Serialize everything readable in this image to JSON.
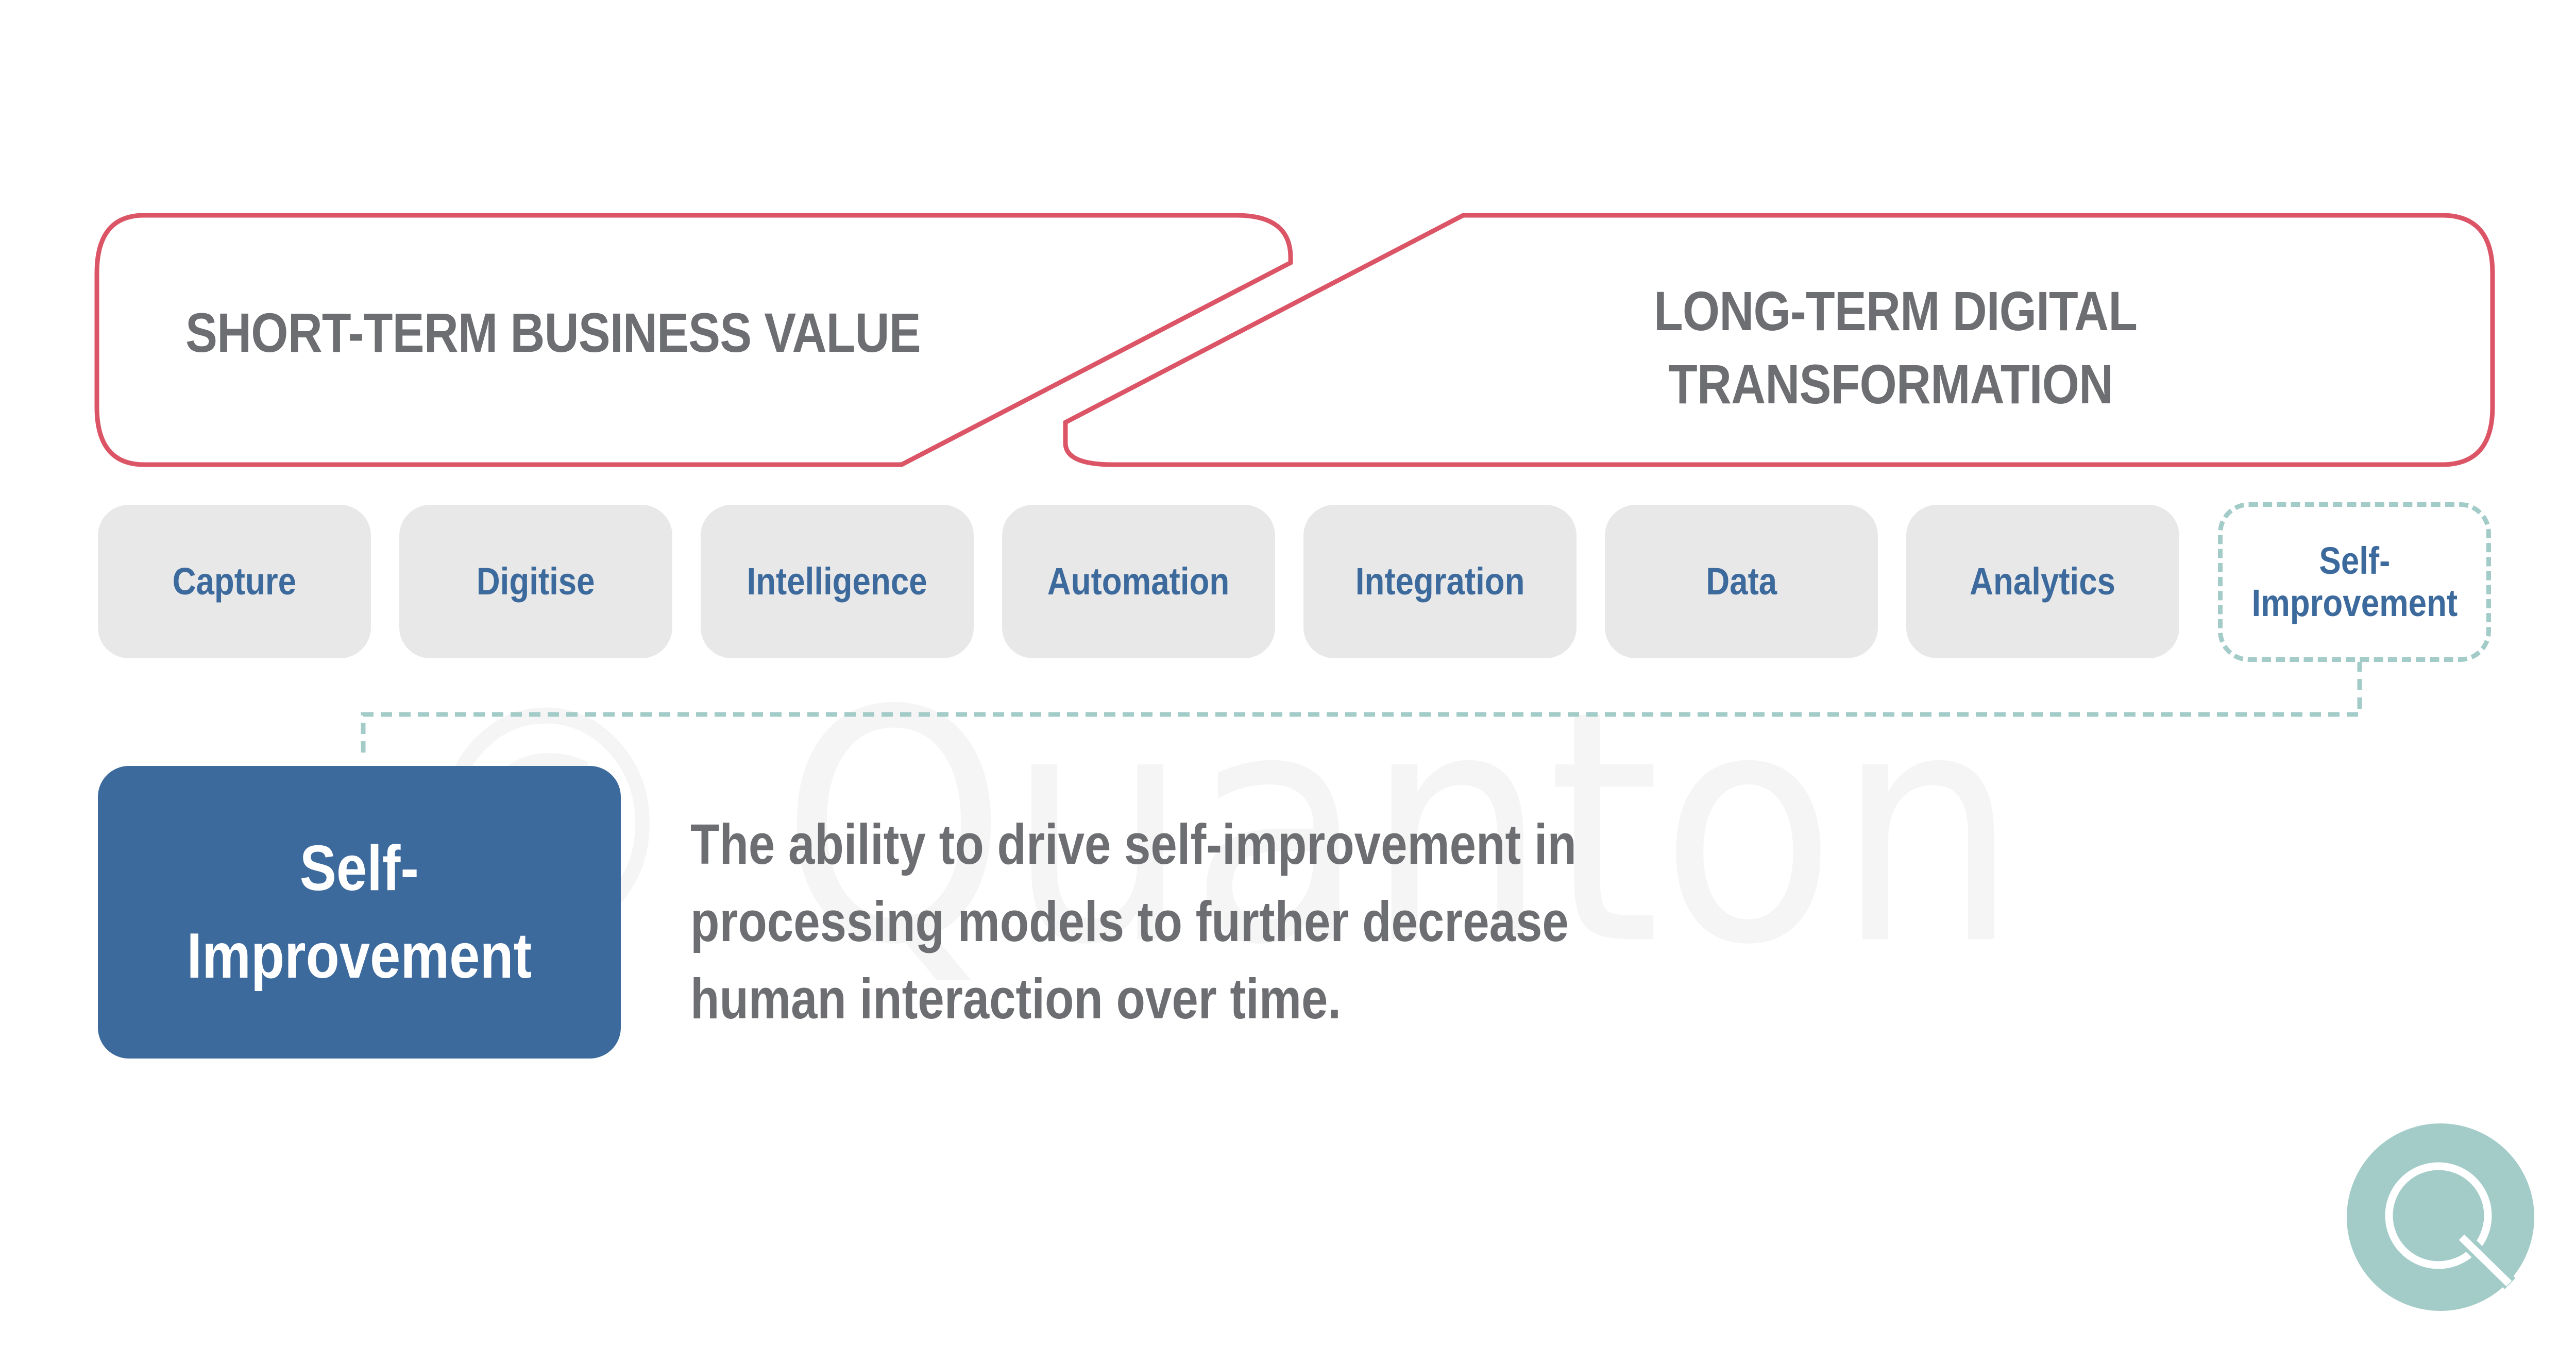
{
  "banners": {
    "short_term": "SHORT-TERM BUSINESS VALUE",
    "long_term_line1": "LONG-TERM DIGITAL",
    "long_term_line2": "TRANSFORMATION"
  },
  "stages": [
    {
      "label": "Capture",
      "active": false
    },
    {
      "label": "Digitise",
      "active": false
    },
    {
      "label": "Intelligence",
      "active": false
    },
    {
      "label": "Automation",
      "active": false
    },
    {
      "label": "Integration",
      "active": false
    },
    {
      "label": "Data",
      "active": false
    },
    {
      "label": "Analytics",
      "active": false
    },
    {
      "label": "Self-\nImprovement",
      "active": true
    }
  ],
  "detail": {
    "title_line1": "Self-",
    "title_line2": "Improvement",
    "description": "The ability to drive self-improvement in processing models to further decrease human interaction over time."
  },
  "watermark": "© Quanton",
  "logo": {
    "letter": "Q",
    "brand": "Quanton"
  },
  "colors": {
    "banner_outline": "#dc5566",
    "heading_gray": "#6d6e71",
    "stage_blue": "#3d6a9c",
    "pill_bg": "#e8e8e8",
    "accent_teal": "#a3ccc9"
  }
}
